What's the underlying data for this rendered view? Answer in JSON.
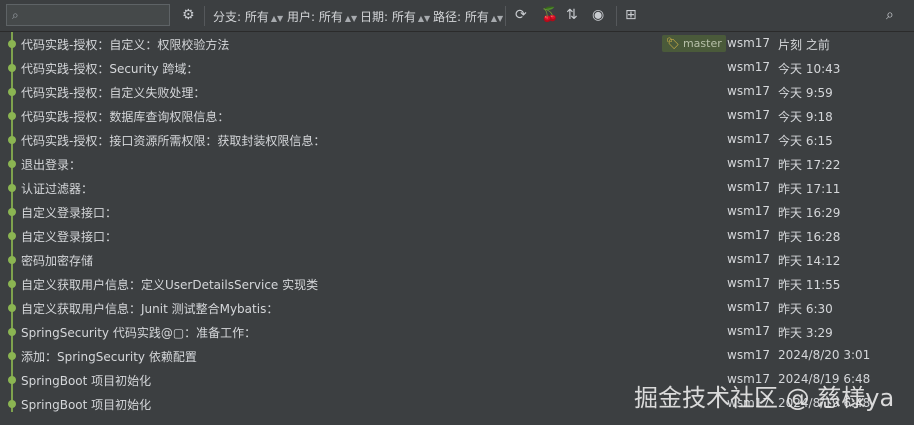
{
  "toolbar": {
    "search_placeholder": "",
    "search_icon": "search-icon",
    "filters": [
      {
        "name": "branch",
        "label": "分支: 所有"
      },
      {
        "name": "user",
        "label": "用户: 所有"
      },
      {
        "name": "date",
        "label": "日期: 所有"
      },
      {
        "name": "path",
        "label": "路径: 所有"
      }
    ]
  },
  "commits": [
    {
      "message": "代码实践-授权：自定义：权限校验方法",
      "author": "wsm17",
      "date": "片刻 之前",
      "tag": "master"
    },
    {
      "message": "代码实践-授权：Security 跨域：",
      "author": "wsm17",
      "date": "今天 10:43"
    },
    {
      "message": "代码实践-授权：自定义失败处理：",
      "author": "wsm17",
      "date": "今天 9:59"
    },
    {
      "message": "代码实践-授权：数据库查询权限信息：",
      "author": "wsm17",
      "date": "今天 9:18"
    },
    {
      "message": "代码实践-授权：接口资源所需权限：获取封装权限信息：",
      "author": "wsm17",
      "date": "今天 6:15"
    },
    {
      "message": "退出登录：",
      "author": "wsm17",
      "date": "昨天 17:22"
    },
    {
      "message": "认证过滤器：",
      "author": "wsm17",
      "date": "昨天 17:11"
    },
    {
      "message": "自定义登录接口：",
      "author": "wsm17",
      "date": "昨天 16:29"
    },
    {
      "message": "自定义登录接口：",
      "author": "wsm17",
      "date": "昨天 16:28"
    },
    {
      "message": "密码加密存储",
      "author": "wsm17",
      "date": "昨天 14:12"
    },
    {
      "message": "自定义获取用户信息：定义UserDetailsService 实现类",
      "author": "wsm17",
      "date": "昨天 11:55"
    },
    {
      "message": "自定义获取用户信息：Junit 测试整合Mybatis：",
      "author": "wsm17",
      "date": "昨天 6:30"
    },
    {
      "message": "SpringSecurity 代码实践@▢：准备工作：",
      "author": "wsm17",
      "date": "昨天 3:29"
    },
    {
      "message": "添加：SpringSecurity 依赖配置",
      "author": "wsm17",
      "date": "2024/8/20 3:01"
    },
    {
      "message": "SpringBoot 项目初始化",
      "author": "wsm17",
      "date": "2024/8/19 6:48"
    },
    {
      "message": "SpringBoot 项目初始化",
      "author": "wsm17",
      "date": "2024/8/19 6:48"
    }
  ],
  "watermark": "掘金技术社区 @ 慈様ya"
}
